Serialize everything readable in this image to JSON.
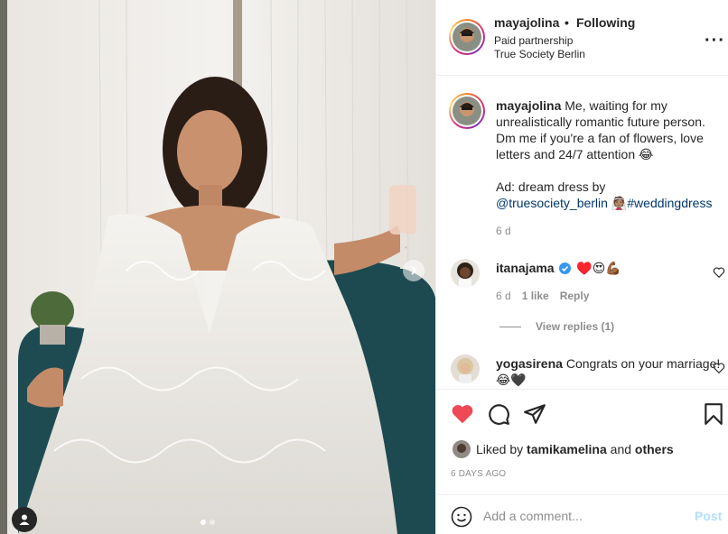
{
  "post": {
    "author": "mayajolina",
    "separator": "•",
    "follow_status": "Following",
    "partnership": "Paid partnership",
    "brand": "True Society Berlin",
    "more_icon": "more-horizontal-icon"
  },
  "caption": {
    "username": "mayajolina",
    "text_line1": "Me, waiting for my unrealistically romantic future person. Dm me if you're a fan of flowers, love letters and 24/7 attention 😂",
    "ad_prefix": "Ad: dream dress by",
    "mention": "@truesociety_berlin",
    "emoji": "👰🏽",
    "hashtag": "#weddingdress",
    "time": "6 d"
  },
  "comments": [
    {
      "username": "itanajama",
      "verified": true,
      "text": "♥️😍💪🏾",
      "time": "6 d",
      "likes": "1 like",
      "reply_label": "Reply",
      "view_replies": "View replies (1)"
    },
    {
      "username": "yogasirena",
      "text": "Congrats on your marriage! 😂🖤"
    }
  ],
  "actions": {
    "liked_prefix": "Liked by",
    "liked_user": "tamikamelina",
    "liked_and": "and",
    "liked_others": "others",
    "posted": "6 DAYS AGO",
    "like_color": "#ed4956"
  },
  "add_comment": {
    "placeholder": "Add a comment...",
    "post_label": "Post"
  },
  "carousel": {
    "slides": 2,
    "active": 1
  }
}
